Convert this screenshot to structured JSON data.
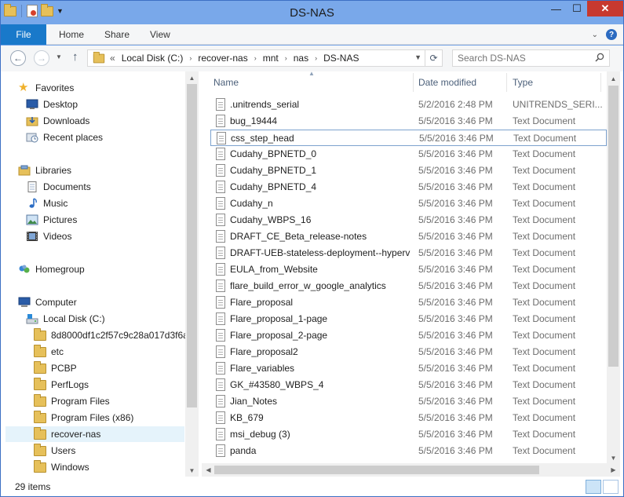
{
  "window": {
    "title": "DS-NAS"
  },
  "ribbon": {
    "tabs": [
      "File",
      "Home",
      "Share",
      "View"
    ]
  },
  "address": {
    "overflow": "«",
    "crumbs": [
      "Local Disk (C:)",
      "recover-nas",
      "mnt",
      "nas",
      "DS-NAS"
    ],
    "search_placeholder": "Search DS-NAS"
  },
  "nav": {
    "favorites": {
      "label": "Favorites",
      "items": [
        "Desktop",
        "Downloads",
        "Recent places"
      ]
    },
    "libraries": {
      "label": "Libraries",
      "items": [
        "Documents",
        "Music",
        "Pictures",
        "Videos"
      ]
    },
    "homegroup": "Homegroup",
    "computer": {
      "label": "Computer",
      "drive": "Local Disk (C:)",
      "folders": [
        "8d8000df1c2f57c9c28a017d3f6a",
        "etc",
        "PCBP",
        "PerfLogs",
        "Program Files",
        "Program Files (x86)",
        "recover-nas",
        "Users",
        "Windows"
      ]
    },
    "selected": "recover-nas"
  },
  "columns": {
    "name": "Name",
    "date": "Date modified",
    "type": "Type"
  },
  "files": [
    {
      "name": ".unitrends_serial",
      "date": "5/2/2016 2:48 PM",
      "type": "UNITRENDS_SERI..."
    },
    {
      "name": "bug_19444",
      "date": "5/5/2016 3:46 PM",
      "type": "Text Document"
    },
    {
      "name": "css_step_head",
      "date": "5/5/2016 3:46 PM",
      "type": "Text Document"
    },
    {
      "name": "Cudahy_BPNETD_0",
      "date": "5/5/2016 3:46 PM",
      "type": "Text Document"
    },
    {
      "name": "Cudahy_BPNETD_1",
      "date": "5/5/2016 3:46 PM",
      "type": "Text Document"
    },
    {
      "name": "Cudahy_BPNETD_4",
      "date": "5/5/2016 3:46 PM",
      "type": "Text Document"
    },
    {
      "name": "Cudahy_n",
      "date": "5/5/2016 3:46 PM",
      "type": "Text Document"
    },
    {
      "name": "Cudahy_WBPS_16",
      "date": "5/5/2016 3:46 PM",
      "type": "Text Document"
    },
    {
      "name": "DRAFT_CE_Beta_release-notes",
      "date": "5/5/2016 3:46 PM",
      "type": "Text Document"
    },
    {
      "name": "DRAFT-UEB-stateless-deployment--hyperv",
      "date": "5/5/2016 3:46 PM",
      "type": "Text Document"
    },
    {
      "name": "EULA_from_Website",
      "date": "5/5/2016 3:46 PM",
      "type": "Text Document"
    },
    {
      "name": "flare_build_error_w_google_analytics",
      "date": "5/5/2016 3:46 PM",
      "type": "Text Document"
    },
    {
      "name": "Flare_proposal",
      "date": "5/5/2016 3:46 PM",
      "type": "Text Document"
    },
    {
      "name": "Flare_proposal_1-page",
      "date": "5/5/2016 3:46 PM",
      "type": "Text Document"
    },
    {
      "name": "Flare_proposal_2-page",
      "date": "5/5/2016 3:46 PM",
      "type": "Text Document"
    },
    {
      "name": "Flare_proposal2",
      "date": "5/5/2016 3:46 PM",
      "type": "Text Document"
    },
    {
      "name": "Flare_variables",
      "date": "5/5/2016 3:46 PM",
      "type": "Text Document"
    },
    {
      "name": "GK_#43580_WBPS_4",
      "date": "5/5/2016 3:46 PM",
      "type": "Text Document"
    },
    {
      "name": "Jian_Notes",
      "date": "5/5/2016 3:46 PM",
      "type": "Text Document"
    },
    {
      "name": "KB_679",
      "date": "5/5/2016 3:46 PM",
      "type": "Text Document"
    },
    {
      "name": "msi_debug (3)",
      "date": "5/5/2016 3:46 PM",
      "type": "Text Document"
    },
    {
      "name": "panda",
      "date": "5/5/2016 3:46 PM",
      "type": "Text Document"
    }
  ],
  "focused_file": "css_step_head",
  "status": {
    "count": "29 items"
  },
  "colors": {
    "title_bar": "#79a8ea",
    "file_tab": "#1979ca",
    "close_button": "#c7392f",
    "selection": "#e5f3fb"
  }
}
